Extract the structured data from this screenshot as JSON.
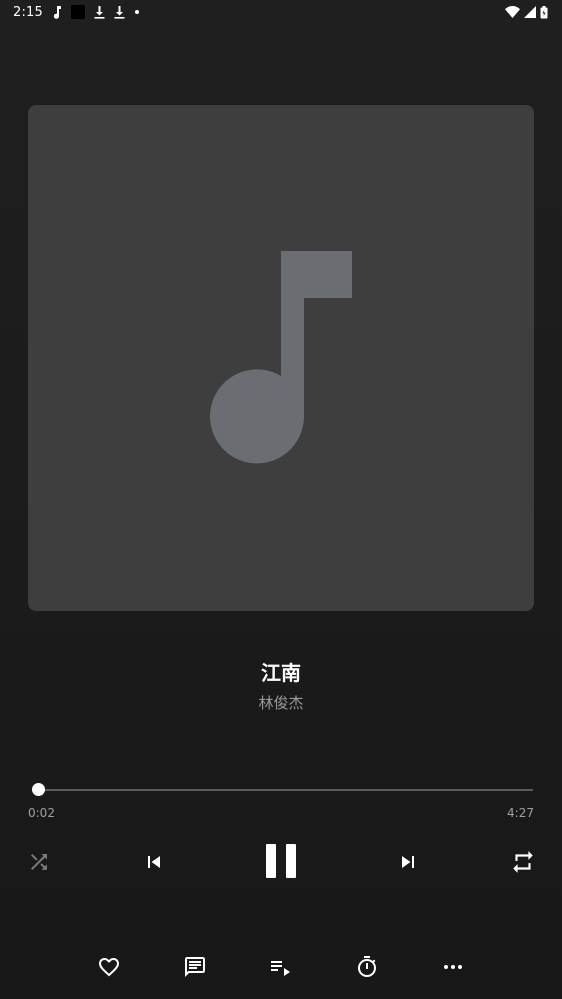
{
  "status_bar": {
    "time": "2:15",
    "notification_icons": [
      "music-note-icon",
      "black-square-icon",
      "download-icon",
      "download-icon",
      "dot-icon"
    ],
    "system_icons": [
      "wifi-icon",
      "cellular-signal-icon",
      "battery-icon"
    ]
  },
  "album_art": {
    "placeholder_icon": "music-note-icon",
    "background_color": "#3e3e3e",
    "icon_color": "#6a6d71"
  },
  "song": {
    "title": "江南",
    "artist": "林俊杰"
  },
  "playback": {
    "elapsed": "0:02",
    "duration": "4:27",
    "progress_fraction": 0.0078
  },
  "controls": {
    "shuffle": "shuffle-icon",
    "previous": "skip-previous-icon",
    "play_pause": "pause-icon",
    "next": "skip-next-icon",
    "repeat": "repeat-icon"
  },
  "actions": [
    "heart-icon",
    "comment-icon",
    "playlist-icon",
    "timer-icon",
    "more-icon"
  ]
}
